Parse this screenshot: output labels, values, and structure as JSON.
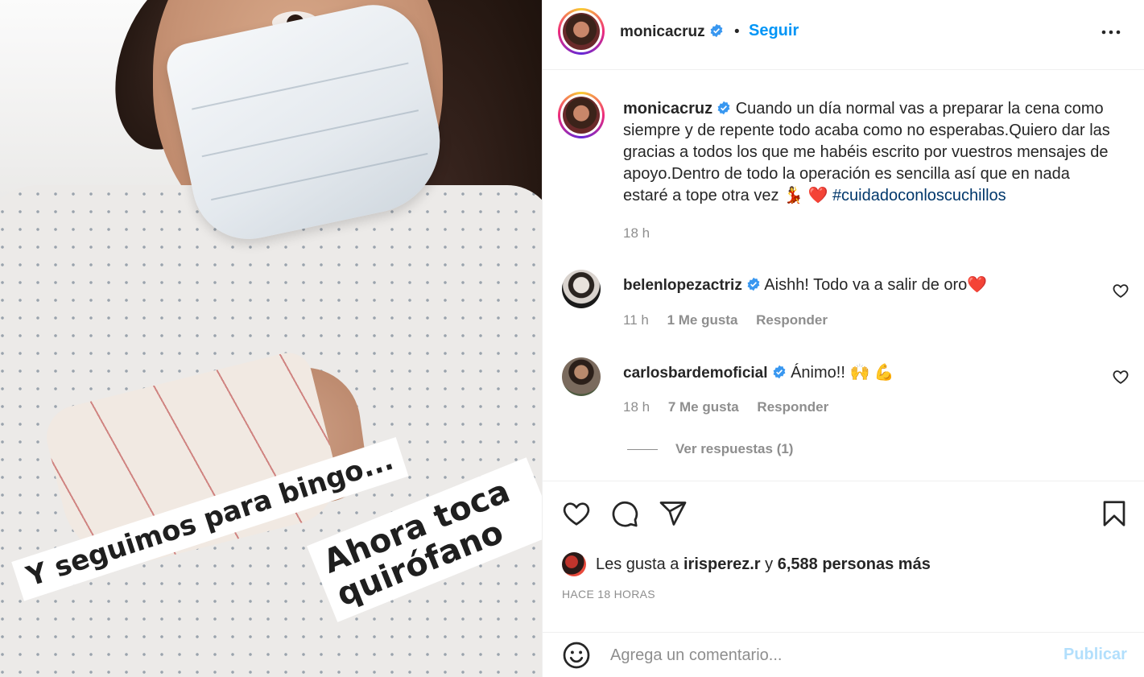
{
  "photo": {
    "text_left": "Y seguimos para bingo...",
    "text_right": "Ahora toca quirófano"
  },
  "header": {
    "username": "monicacruz",
    "separator": "•",
    "follow_label": "Seguir",
    "more_icon": "more-horizontal-icon"
  },
  "caption": {
    "username": "monicacruz",
    "text": "Cuando un día normal vas a preparar la cena como siempre y de repente todo acaba como no esperabas.Quiero dar las gracias a todos los que me habéis escrito por vuestros mensajes de apoyo.Dentro de todo la operación es sencilla así que en nada estaré a tope otra vez 💃 ❤️",
    "hashtag": "#cuidadoconloscuchillos",
    "time": "18 h"
  },
  "comments": [
    {
      "username": "belenlopezactriz",
      "text": "Aishh! Todo va a salir de oro❤️",
      "time": "11 h",
      "likes": "1 Me gusta",
      "reply": "Responder"
    },
    {
      "username": "carlosbardemoficial",
      "text": "Ánimo!! 🙌 💪",
      "time": "18 h",
      "likes": "7 Me gusta",
      "reply": "Responder"
    }
  ],
  "view_replies": "Ver respuestas (1)",
  "likes": {
    "prefix": "Les gusta a",
    "user": "irisperez.r",
    "conj": "y",
    "count": "6,588 personas más"
  },
  "timestamp": "HACE 18 HORAS",
  "composer": {
    "placeholder": "Agrega un comentario...",
    "publish": "Publicar"
  },
  "colors": {
    "link": "#0095f6",
    "hashtag": "#00376b",
    "muted": "#8e8e8e",
    "publish_disabled": "#b2dffc"
  }
}
